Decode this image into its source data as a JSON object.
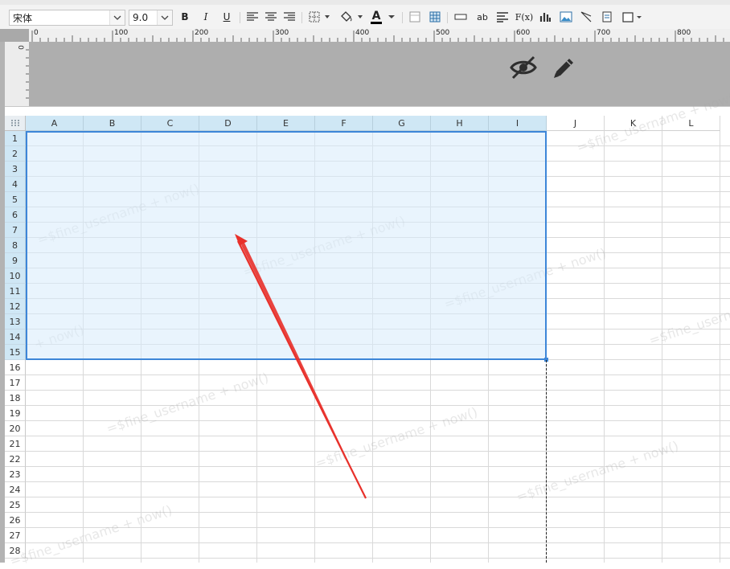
{
  "toolbar": {
    "font_family": "宋体",
    "font_size": "9.0",
    "bold_label": "B",
    "italic_label": "I",
    "underline_label": "U",
    "text_wrap_label": "ab",
    "formula_label": "F(x)",
    "font_color_label": "A"
  },
  "ruler": {
    "ticks": [
      "0",
      "100",
      "200",
      "300",
      "400",
      "500",
      "600",
      "700",
      "800"
    ],
    "side_tick": "0"
  },
  "columns": [
    "A",
    "B",
    "C",
    "D",
    "E",
    "F",
    "G",
    "H",
    "I",
    "J",
    "K",
    "L"
  ],
  "rows": [
    "1",
    "2",
    "3",
    "4",
    "5",
    "6",
    "7",
    "8",
    "9",
    "10",
    "11",
    "12",
    "13",
    "14",
    "15",
    "16",
    "17",
    "18",
    "19",
    "20",
    "21",
    "22",
    "23",
    "24",
    "25",
    "26",
    "27",
    "28"
  ],
  "watermark": "=$fine_username + now()",
  "watermark_tail": "+ now()",
  "colors": {
    "selection_border": "#3d86d8",
    "arrow": "#e8302a",
    "header_selected": "#cfe7f5"
  }
}
